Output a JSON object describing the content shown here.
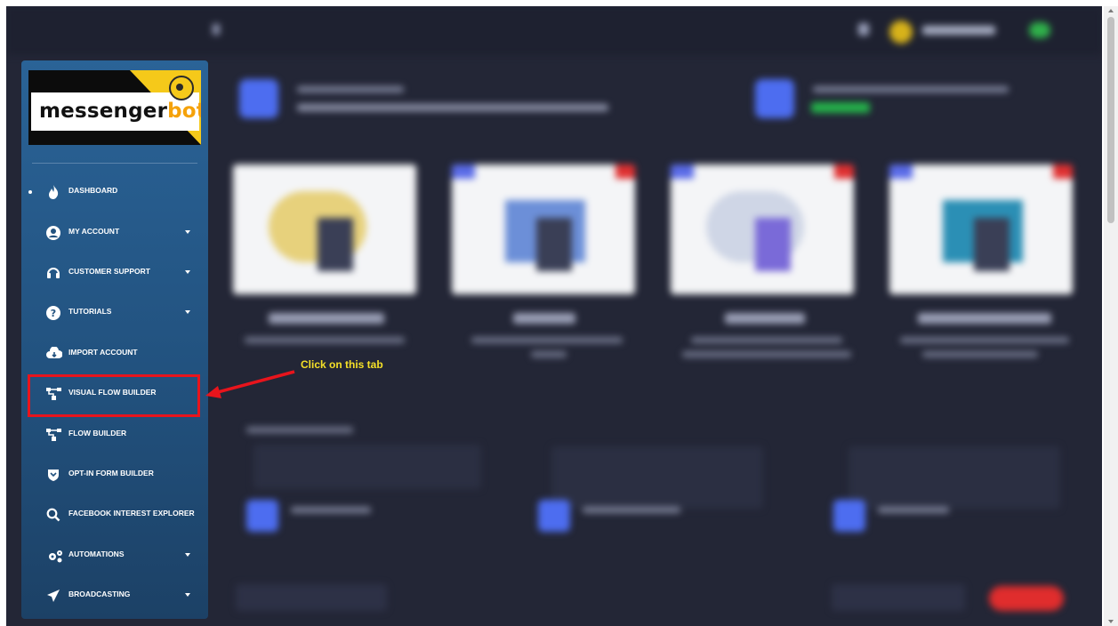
{
  "sidebar": {
    "logo": {
      "text_main": "messenger",
      "text_accent": "bot"
    },
    "items": [
      {
        "label": "DASHBOARD",
        "icon": "fire-icon",
        "has_caret": false
      },
      {
        "label": "MY ACCOUNT",
        "icon": "user-circle-icon",
        "has_caret": true
      },
      {
        "label": "CUSTOMER SUPPORT",
        "icon": "headset-icon",
        "has_caret": true
      },
      {
        "label": "TUTORIALS",
        "icon": "question-circle-icon",
        "has_caret": true
      },
      {
        "label": "IMPORT ACCOUNT",
        "icon": "cloud-download-icon",
        "has_caret": false
      },
      {
        "label": "VISUAL FLOW BUILDER",
        "icon": "flow-icon",
        "has_caret": false
      },
      {
        "label": "FLOW BUILDER",
        "icon": "flow-icon",
        "has_caret": false
      },
      {
        "label": "OPT-IN FORM BUILDER",
        "icon": "shield-icon",
        "has_caret": false
      },
      {
        "label": "FACEBOOK INTEREST EXPLORER",
        "icon": "search-icon",
        "has_caret": false
      },
      {
        "label": "AUTOMATIONS",
        "icon": "gears-icon",
        "has_caret": true
      },
      {
        "label": "BROADCASTING",
        "icon": "paper-plane-icon",
        "has_caret": true
      }
    ]
  },
  "annotation": {
    "text": "Click on this tab"
  },
  "colors": {
    "highlight": "#e8141c",
    "annotation_text": "#f5e027",
    "sidebar_top": "#2a6397",
    "sidebar_bottom": "#1c4166",
    "background": "#232636",
    "logo_accent": "#f5a20a"
  }
}
